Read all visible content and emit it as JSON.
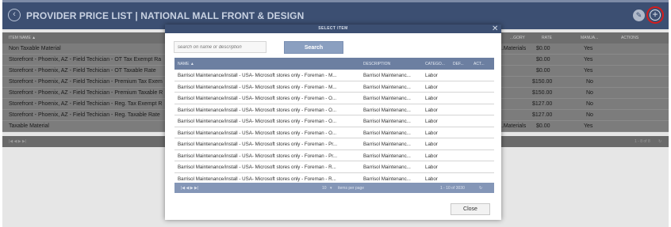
{
  "header": {
    "title": "PROVIDER PRICE LIST | NATIONAL MALL FRONT & DESIGN",
    "back_icon": "chevron-left-circle-icon",
    "tag_icon": "tag-icon",
    "add_icon": "plus-circle-icon"
  },
  "grid": {
    "columns": [
      "ITEM NAME ▲",
      "...GORY",
      "RATE",
      "MANUA...",
      "ACTIONS"
    ],
    "rows": [
      {
        "name": "Non Taxable Material",
        "category": "...Materials",
        "rate": "$0.00",
        "manual": "Yes"
      },
      {
        "name": "Storefront - Phoenix, AZ - Field Techician - OT Tax Exempt Ra",
        "category": "",
        "rate": "$0.00",
        "manual": "Yes"
      },
      {
        "name": "Storefront - Phoenix, AZ - Field Techician - OT Taxable Rate",
        "category": "",
        "rate": "$0.00",
        "manual": "Yes"
      },
      {
        "name": "Storefront - Phoenix, AZ - Field Techician - Premium Tax Exem",
        "category": "",
        "rate": "$150.00",
        "manual": "No"
      },
      {
        "name": "Storefront - Phoenix, AZ - Field Techician - Premium Taxable R",
        "category": "",
        "rate": "$150.00",
        "manual": "No"
      },
      {
        "name": "Storefront - Phoenix, AZ - Field Techician - Reg. Tax Exempt R",
        "category": "",
        "rate": "$127.00",
        "manual": "No"
      },
      {
        "name": "Storefront - Phoenix, AZ - Field Techician - Reg. Taxable Rate",
        "category": "",
        "rate": "$127.00",
        "manual": "No"
      },
      {
        "name": "Taxable Material",
        "category": "...Materials",
        "rate": "$0.00",
        "manual": "Yes"
      }
    ],
    "pager_nav": "|◀  ◀  ▶  ▶|",
    "pager_info": "1 - 8 of 8"
  },
  "modal": {
    "title": "SELECT ITEM",
    "search_placeholder": "search on name or description",
    "search_label": "Search",
    "columns": [
      "NAME ▲",
      "DESCRIPTION",
      "CATEGO...",
      "DEF...",
      "ACT..."
    ],
    "rows": [
      {
        "name": "Barrisol Maintenance/install - USA- Microsoft stores only - Foreman - M...",
        "description": "Barrisol Maintenanc...",
        "category": "Labor"
      },
      {
        "name": "Barrisol Maintenance/install - USA- Microsoft stores only - Foreman - M...",
        "description": "Barrisol Maintenanc...",
        "category": "Labor"
      },
      {
        "name": "Barrisol Maintenance/install - USA- Microsoft stores only - Foreman - O...",
        "description": "Barrisol Maintenanc...",
        "category": "Labor"
      },
      {
        "name": "Barrisol Maintenance/install - USA- Microsoft stores only - Foreman - O...",
        "description": "Barrisol Maintenanc...",
        "category": "Labor"
      },
      {
        "name": "Barrisol Maintenance/install - USA- Microsoft stores only - Foreman - O...",
        "description": "Barrisol Maintenanc...",
        "category": "Labor"
      },
      {
        "name": "Barrisol Maintenance/install - USA- Microsoft stores only - Foreman - O...",
        "description": "Barrisol Maintenanc...",
        "category": "Labor"
      },
      {
        "name": "Barrisol Maintenance/install - USA- Microsoft stores only - Foreman - Pr...",
        "description": "Barrisol Maintenanc...",
        "category": "Labor"
      },
      {
        "name": "Barrisol Maintenance/install - USA- Microsoft stores only - Foreman - Pr...",
        "description": "Barrisol Maintenanc...",
        "category": "Labor"
      },
      {
        "name": "Barrisol Maintenance/install - USA- Microsoft stores only - Foreman - R...",
        "description": "Barrisol Maintenanc...",
        "category": "Labor"
      },
      {
        "name": "Barrisol Maintenance/install - USA- Microsoft stores only - Foreman - R...",
        "description": "Barrisol Maintenanc...",
        "category": "Labor"
      }
    ],
    "pager_nav": "|◀  ◀   ▶  ▶|",
    "page_size": "10",
    "page_size_label": "items per page",
    "pager_info": "1 - 10 of 3030",
    "close_label": "Close"
  },
  "colors": {
    "header_bg": "#3c4f72",
    "highlight_ring": "#d41c1c",
    "modal_header": "#6c7fa1",
    "search_button": "#8a9fc0"
  }
}
